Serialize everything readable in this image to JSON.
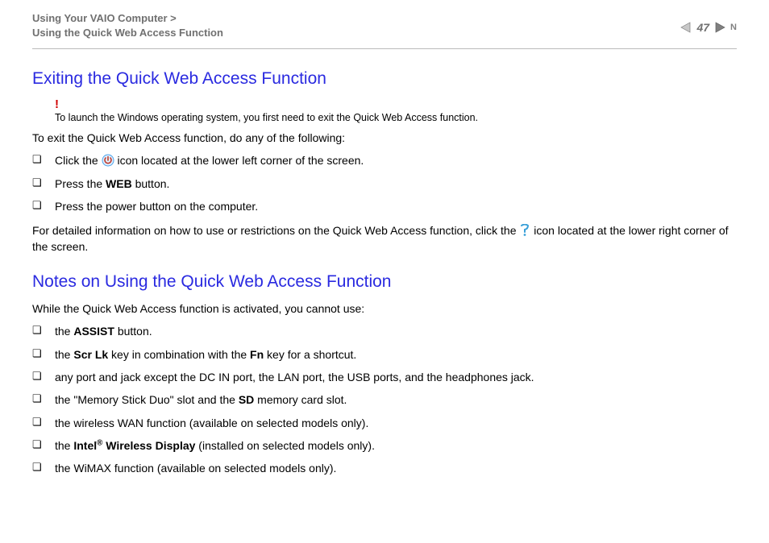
{
  "header": {
    "breadcrumb_line1": "Using Your VAIO Computer >",
    "breadcrumb_line2": "Using the Quick Web Access Function",
    "page_number": "47"
  },
  "section1": {
    "title": "Exiting the Quick Web Access Function",
    "alert_text": "To launch the Windows operating system, you first need to exit the Quick Web Access function.",
    "intro": "To exit the Quick Web Access function, do any of the following:",
    "item1_pre": "Click the ",
    "item1_post": " icon located at the lower left corner of the screen.",
    "item2_pre": "Press the ",
    "item2_bold": "WEB",
    "item2_post": " button.",
    "item3": "Press the power button on the computer.",
    "detail_pre": "For detailed information on how to use or restrictions on the Quick Web Access function, click the ",
    "detail_post": " icon located at the lower right corner of the screen."
  },
  "section2": {
    "title": "Notes on Using the Quick Web Access Function",
    "intro": "While the Quick Web Access function is activated, you cannot use:",
    "item1_pre": "the ",
    "item1_bold": "ASSIST",
    "item1_post": " button.",
    "item2_a": "the ",
    "item2_b": "Scr Lk",
    "item2_c": " key in combination with the ",
    "item2_d": "Fn",
    "item2_e": " key for a shortcut.",
    "item3": "any port and jack except the DC IN port, the LAN port, the USB ports, and the headphones jack.",
    "item4_a": "the \"Memory Stick Duo\" slot and the ",
    "item4_b": "SD",
    "item4_c": " memory card slot.",
    "item5": "the wireless WAN function (available on selected models only).",
    "item6_a": "the ",
    "item6_b": "Intel",
    "item6_sup": "®",
    "item6_c": " Wireless Display",
    "item6_d": " (installed on selected models only).",
    "item7": "the WiMAX function (available on selected models only)."
  }
}
